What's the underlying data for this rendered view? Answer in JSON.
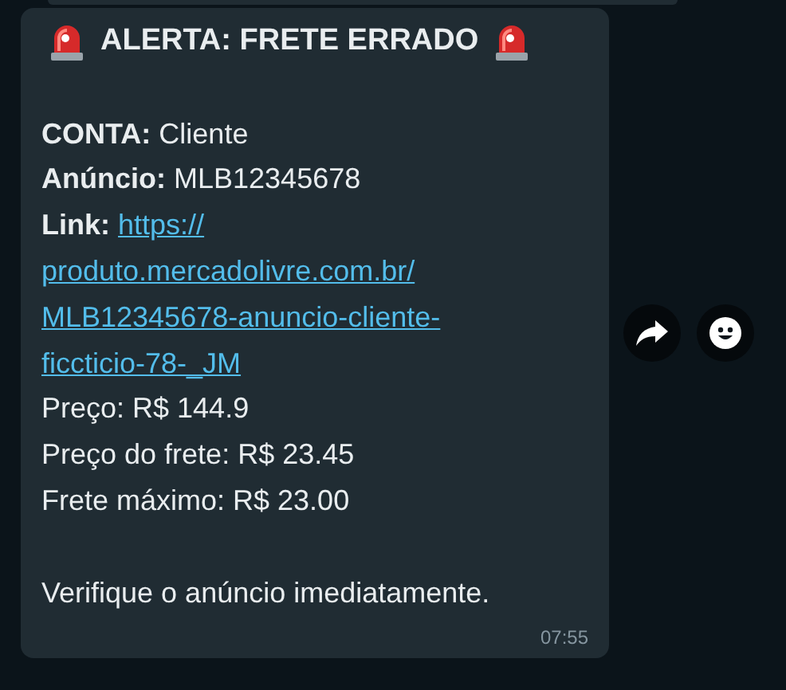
{
  "message": {
    "paragraphs": [
      {
        "lines": [
          {
            "kind": "title",
            "text": "ALERTA: FRETE ERRADO"
          }
        ]
      },
      {
        "lines": [
          {
            "kind": "field",
            "label": "CONTA:",
            "value": "Cliente"
          },
          {
            "kind": "field",
            "label": "Anúncio:",
            "value": "MLB12345678"
          },
          {
            "kind": "link",
            "label": "Link:",
            "lines": [
              "https://",
              "produto.mercadolivre.com.br/",
              "MLB12345678-anuncio-cliente-",
              "ficcticio-78-_JM"
            ]
          },
          {
            "kind": "text",
            "text": "Preço: R$ 144.9"
          },
          {
            "kind": "text",
            "text": "Preço do frete: R$ 23.45"
          },
          {
            "kind": "text",
            "text": "Frete máximo: R$ 23.00"
          }
        ]
      },
      {
        "lines": [
          {
            "kind": "text",
            "text": "Verifique o anúncio imediatamente."
          }
        ]
      }
    ],
    "time": "07:55"
  }
}
